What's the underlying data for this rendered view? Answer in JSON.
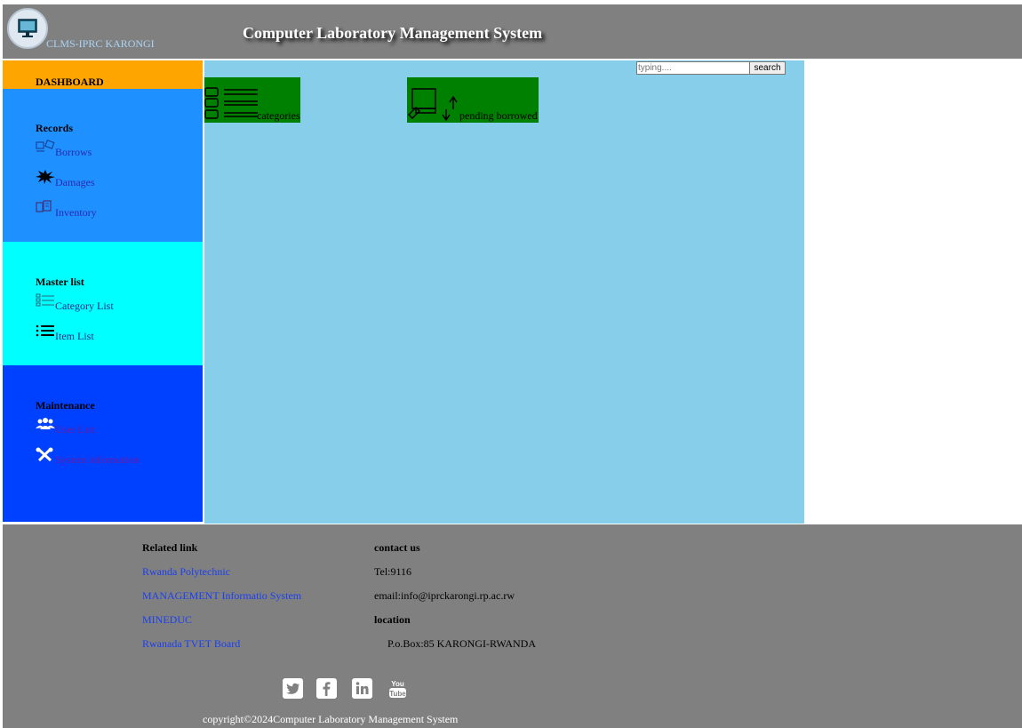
{
  "header": {
    "brand": "CLMS-IPRC KARONGI",
    "title": "Computer Laboratory Management System"
  },
  "sidebar": {
    "dashboard": "DASHBOARD",
    "records": {
      "title": "Records",
      "items": [
        {
          "label": "Borrows",
          "icon": "borrow-icon"
        },
        {
          "label": "Damages",
          "icon": "damage-icon"
        },
        {
          "label": "Inventory",
          "icon": "inventory-icon"
        }
      ]
    },
    "master": {
      "title": "Master list",
      "items": [
        {
          "label": "Category List",
          "icon": "category-list-icon"
        },
        {
          "label": "Item List",
          "icon": "item-list-icon"
        }
      ]
    },
    "maintenance": {
      "title": "Maintenance",
      "items": [
        {
          "label": "User List",
          "icon": "users-icon"
        },
        {
          "label": "System information",
          "icon": "tools-icon"
        }
      ]
    }
  },
  "search": {
    "placeholder": "typing....",
    "button": "search"
  },
  "cards": [
    {
      "label": "categories",
      "icon": "category-list-icon"
    },
    {
      "label": "pending borrowed",
      "icon": "borrow-transfer-icon"
    }
  ],
  "footer": {
    "related_title": "Related link",
    "links": [
      "Rwanda Polytechnic",
      "MANAGEMENT Informatio System",
      "MINEDUC",
      "Rwanada TVET Board"
    ],
    "contact_title": "contact us",
    "tel": "Tel:9116",
    "email": "email:info@iprckarongi.rp.ac.rw",
    "location_title": "location",
    "address": "P.o.Box:85 KARONGI-RWANDA",
    "social": [
      "twitter-icon",
      "facebook-icon",
      "linkedin-icon",
      "youtube-icon"
    ],
    "copyright": "copyright©2024Computer Laboratory Management System"
  },
  "colors": {
    "header": "#808080",
    "dashboard": "#ffa500",
    "records": "#1e90ff",
    "master": "#00ffff",
    "maintenance": "#0040ff",
    "main": "#87ceeb",
    "card": "#008000"
  }
}
